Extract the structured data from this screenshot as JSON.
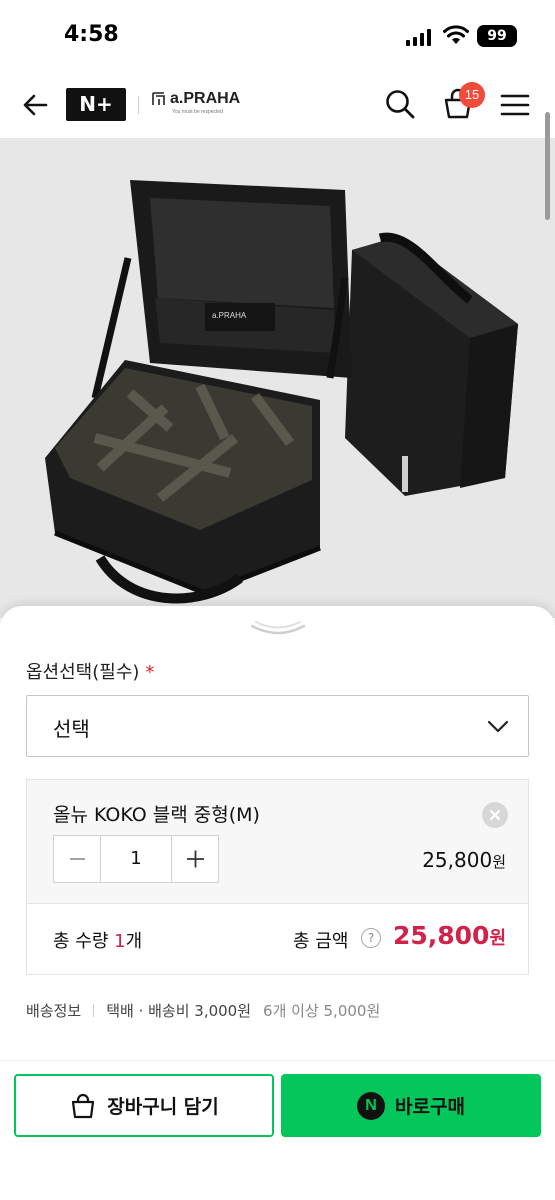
{
  "status_bar": {
    "time": "4:58",
    "battery": "99"
  },
  "header": {
    "store_logo": "N+",
    "brand_name": "a.PRAHA",
    "brand_tagline": "You must be respected",
    "cart_count": "15",
    "icons": [
      "back-arrow-icon",
      "search-icon",
      "cart-icon",
      "menu-icon"
    ]
  },
  "product": {
    "image_label": "a.PRAHA"
  },
  "option_sheet": {
    "option_label": "옵션선택(필수)",
    "required_mark": "*",
    "select_value": "선택",
    "selected_item": {
      "name": "올뉴 KOKO 블랙 중형(M)",
      "quantity": "1",
      "price": "25,800",
      "price_unit": "원"
    },
    "total": {
      "qty_label": "총 수량",
      "qty_value": "1",
      "qty_unit": "개",
      "amount_label": "총 금액",
      "help": "?",
      "amount": "25,800",
      "amount_unit": "원"
    },
    "shipping": {
      "label": "배송정보",
      "method": "택배 · 배송비 3,000원",
      "extra": "6개 이상 5,000원"
    }
  },
  "actions": {
    "cart_label": "장바구니 담기",
    "buy_label": "바로구매",
    "buy_icon_text": "N"
  },
  "colors": {
    "accent_green": "#03c75a",
    "price_red": "#d1224a",
    "badge_red": "#f04b3b"
  }
}
